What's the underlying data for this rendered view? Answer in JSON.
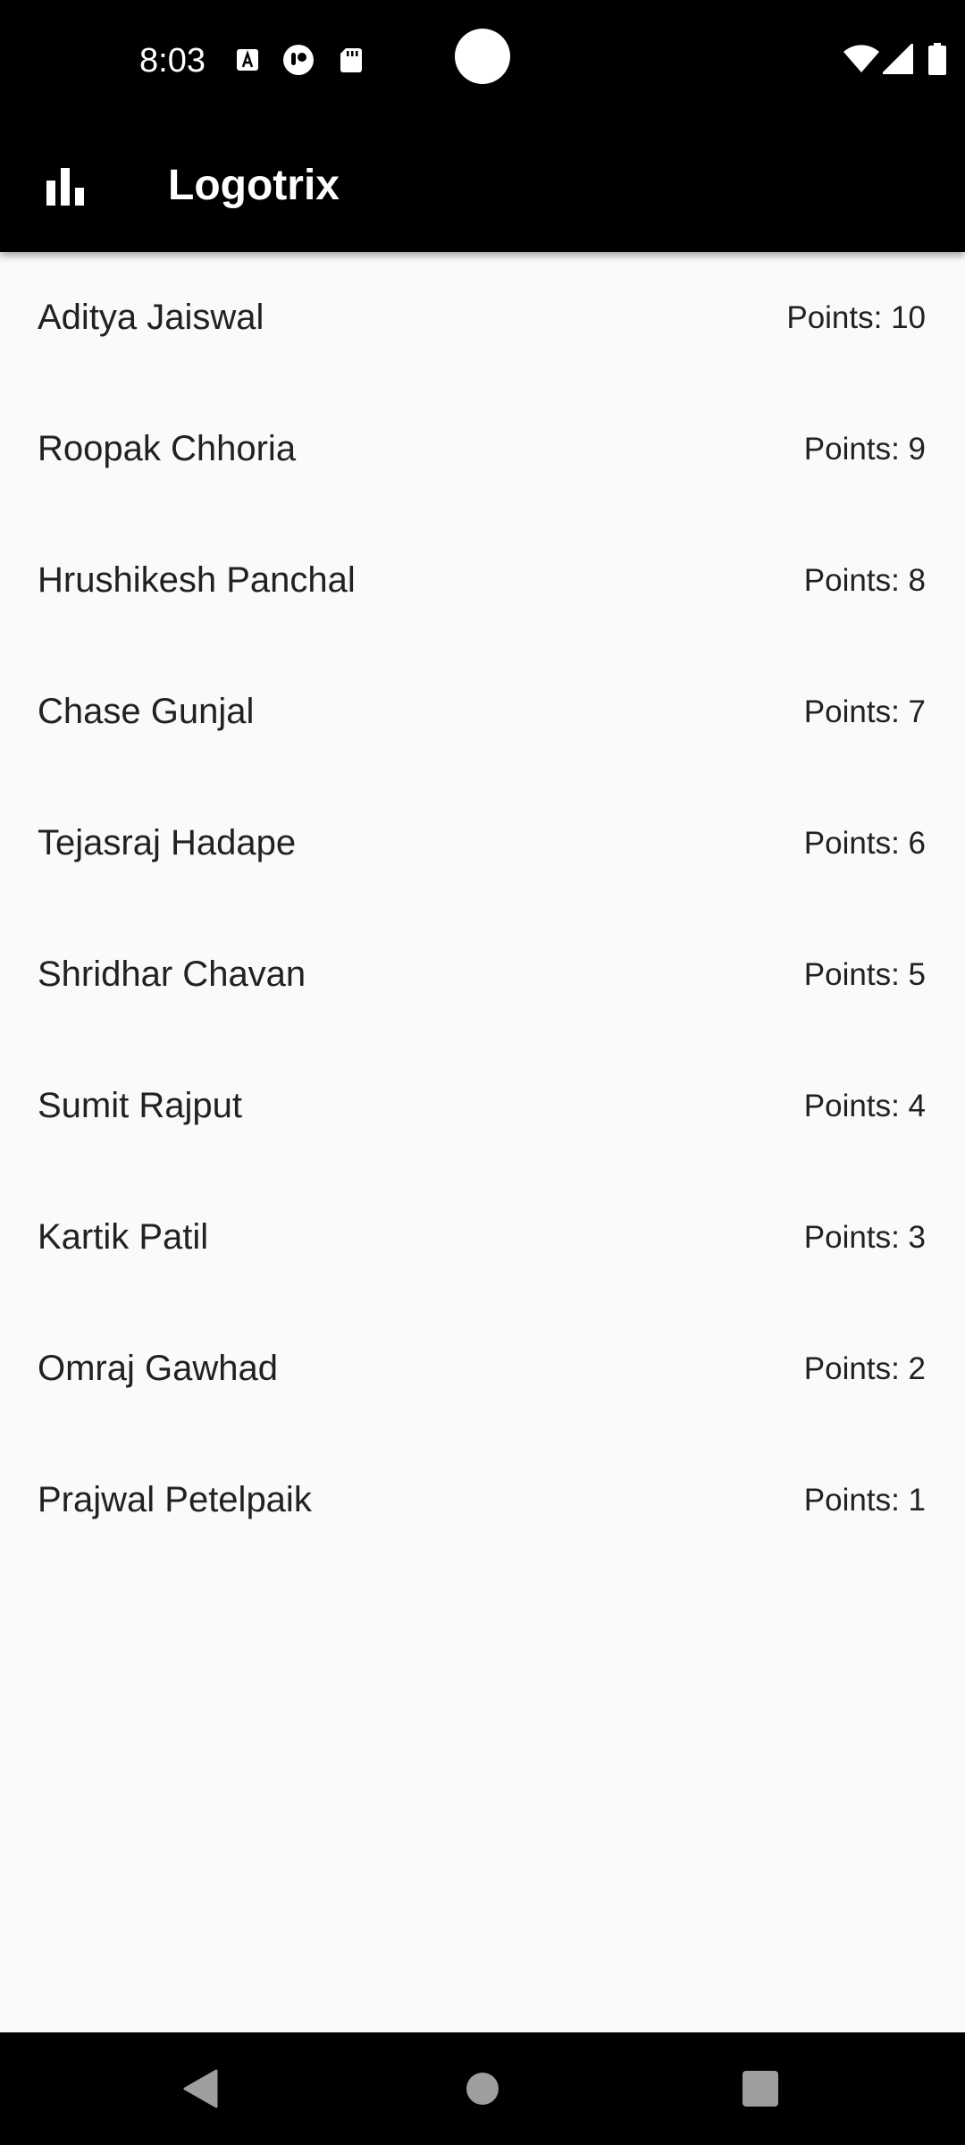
{
  "status_bar": {
    "time": "8:03",
    "left_icons": [
      "text-a-icon",
      "notification-app-icon",
      "sd-card-icon"
    ],
    "right_icons": [
      "wifi-icon",
      "cellular-signal-icon",
      "battery-icon"
    ]
  },
  "app_bar": {
    "icon": "leaderboard-icon",
    "title": "Logotrix"
  },
  "leaderboard": {
    "entries": [
      {
        "name": "Aditya Jaiswal",
        "points": "Points: 10"
      },
      {
        "name": "Roopak Chhoria",
        "points": "Points: 9"
      },
      {
        "name": "Hrushikesh Panchal",
        "points": "Points: 8"
      },
      {
        "name": "Chase Gunjal",
        "points": "Points: 7"
      },
      {
        "name": "Tejasraj Hadape",
        "points": "Points: 6"
      },
      {
        "name": "Shridhar Chavan",
        "points": "Points: 5"
      },
      {
        "name": "Sumit Rajput",
        "points": "Points: 4"
      },
      {
        "name": "Kartik Patil",
        "points": "Points: 3"
      },
      {
        "name": "Omraj Gawhad",
        "points": "Points: 2"
      },
      {
        "name": "Prajwal Petelpaik",
        "points": "Points: 1"
      }
    ]
  },
  "nav_bar": {
    "buttons": [
      "back-icon",
      "home-icon",
      "recents-icon"
    ]
  },
  "colors": {
    "bar_background": "#000000",
    "content_background": "#fafafa",
    "text_primary": "#212121"
  }
}
